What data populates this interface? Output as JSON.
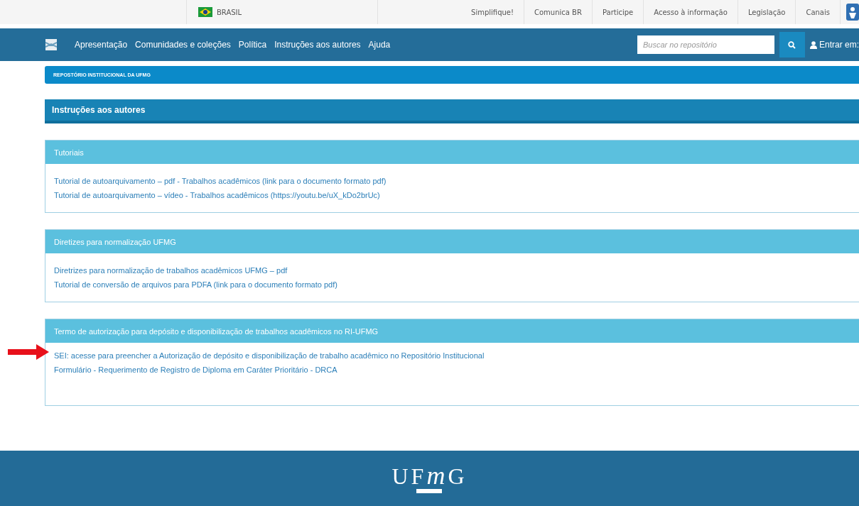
{
  "gov_bar": {
    "country": "BRASIL",
    "links": [
      "Simplifique!",
      "Comunica BR",
      "Participe",
      "Acesso à informação",
      "Legislação",
      "Canais"
    ]
  },
  "navbar": {
    "links": [
      "Apresentação",
      "Comunidades e coleções",
      "Política",
      "Instruções aos autores",
      "Ajuda"
    ],
    "search": {
      "placeholder": "Buscar no repositório"
    },
    "login": "Entrar em:"
  },
  "breadcrumb": "REPOSTÓRIO INSTITUCIONAL DA UFMG",
  "page_title": "Instruções aos autores",
  "panels": [
    {
      "title": "Tutoriais",
      "links": [
        {
          "text": "Tutorial de autoarquivamento – pdf - Trabalhos acadêmicos (link para o documento formato pdf)",
          "marked": false
        },
        {
          "text": "Tutorial de autoarquivamento – vídeo - Trabalhos acadêmicos (https://youtu.be/uX_kDo2brUc)",
          "marked": false
        }
      ]
    },
    {
      "title": "Diretizes para normalização UFMG",
      "links": [
        {
          "text": "Diretrizes para normalização de trabalhos acadêmicos UFMG – pdf",
          "marked": false
        },
        {
          "text": "Tutorial de conversão de arquivos para PDFA (link para o documento formato pdf)",
          "marked": false
        }
      ]
    },
    {
      "title": "Termo de autorização para depósito e disponibilização de trabalhos acadêmicos no RI-UFMG",
      "links": [
        {
          "text": "SEI: acesse para preencher a Autorização de depósito e disponibilização de trabalho acadêmico no Repositório Institucional",
          "marked": true
        },
        {
          "text": "Formulário - Requerimento de Registro de Diploma em Caráter Prioritário - DRCA",
          "marked": false
        }
      ]
    }
  ],
  "footer": {
    "logo": {
      "start": "UF",
      "script": "m",
      "end": "G"
    }
  }
}
